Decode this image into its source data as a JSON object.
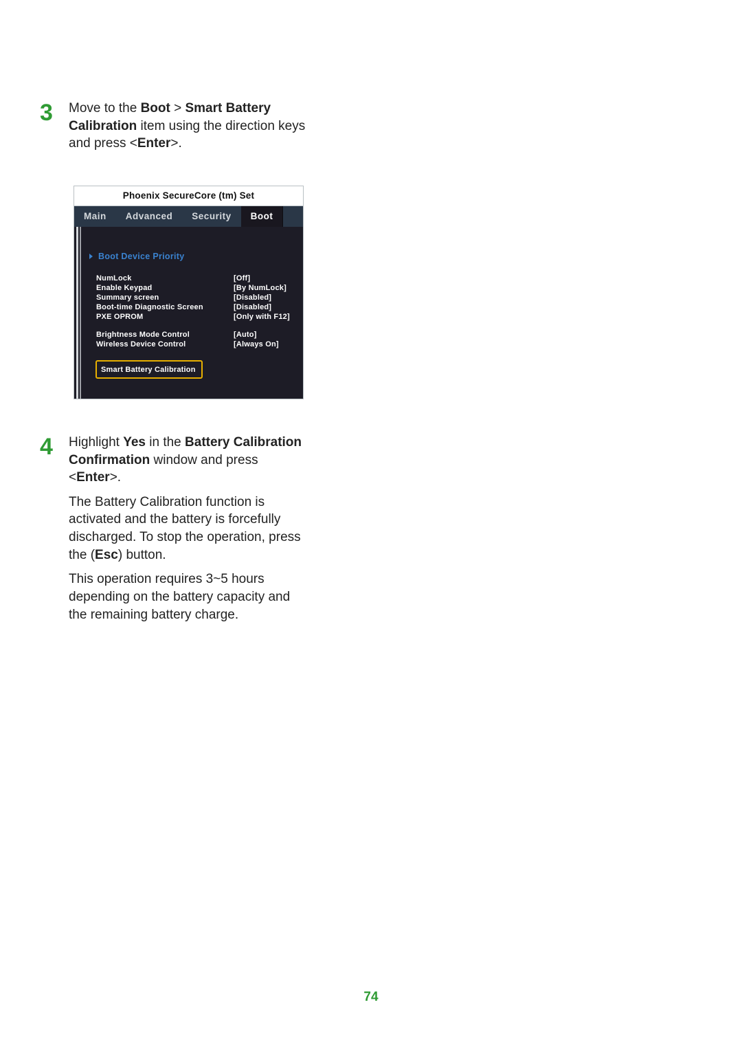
{
  "step3": {
    "number": "3",
    "text_plain": "Move to the ",
    "bold1": "Boot",
    "gt": " > ",
    "bold2": "Smart Battery Calibration",
    "rest": " item using the direction keys and press <",
    "bold3": "Enter",
    "rest2": ">."
  },
  "bios": {
    "title": "Phoenix SecureCore (tm) Set",
    "tabs": {
      "main": "Main",
      "advanced": "Advanced",
      "security": "Security",
      "boot": "Boot"
    },
    "subhead": "Boot Device Priority",
    "rows": [
      {
        "label": "NumLock",
        "value": "[Off]"
      },
      {
        "label": "Enable Keypad",
        "value": "[By NumLock]"
      },
      {
        "label": "Summary screen",
        "value": "[Disabled]"
      },
      {
        "label": "Boot-time Diagnostic Screen",
        "value": "[Disabled]"
      },
      {
        "label": "PXE OPROM",
        "value": "[Only with F12]"
      }
    ],
    "rows2": [
      {
        "label": "Brightness Mode Control",
        "value": "[Auto]"
      },
      {
        "label": "Wireless Device Control",
        "value": "[Always On]"
      }
    ],
    "highlight": "Smart Battery Calibration"
  },
  "step4": {
    "number": "4",
    "line1a": "Highlight ",
    "line1b": "Yes",
    "line1c": " in the ",
    "line1d": "Battery Calibration Confirmation",
    "line1e": " window and press <",
    "line1f": "Enter",
    "line1g": ">.",
    "para2a": "The Battery Calibration function is activated and the battery is forcefully discharged. To stop the operation, press the (",
    "para2b": "Esc",
    "para2c": ") button.",
    "para3": "This operation requires 3~5 hours depending on the battery capacity and the remaining battery charge."
  },
  "pageNumber": "74"
}
